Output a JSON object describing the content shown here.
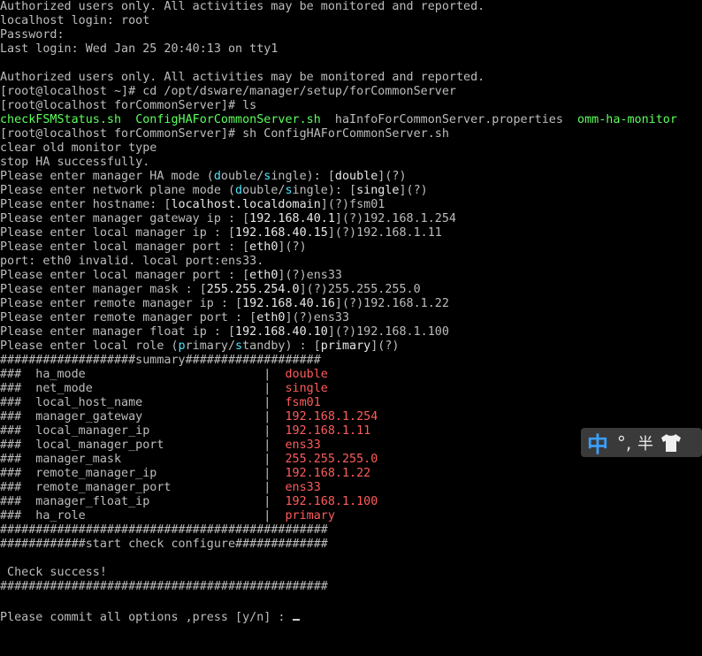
{
  "terminal": {
    "lines": [
      [
        {
          "t": "Authorized users only. All activities may be monitored and reported."
        }
      ],
      [
        {
          "t": "localhost login: root"
        }
      ],
      [
        {
          "t": "Password:"
        }
      ],
      [
        {
          "t": "Last login: Wed Jan 25 20:40:13 on tty1"
        }
      ],
      [
        {
          "t": ""
        }
      ],
      [
        {
          "t": "Authorized users only. All activities may be monitored and reported."
        }
      ],
      [
        {
          "t": "[root@localhost ~]# cd /opt/dsware/manager/setup/forCommonServer"
        }
      ],
      [
        {
          "t": "[root@localhost forCommonServer]# ls"
        }
      ],
      [
        {
          "t": "checkFSMStatus.sh",
          "c": "green"
        },
        {
          "t": "  "
        },
        {
          "t": "ConfigHAForCommonServer.sh",
          "c": "green"
        },
        {
          "t": "  haInfoForCommonServer.properties  "
        },
        {
          "t": "omm-ha-monitor",
          "c": "green"
        }
      ],
      [
        {
          "t": "[root@localhost forCommonServer]# sh ConfigHAForCommonServer.sh"
        }
      ],
      [
        {
          "t": "clear old monitor type"
        }
      ],
      [
        {
          "t": "stop HA successfully."
        }
      ],
      [
        {
          "t": "Please enter manager HA mode ("
        },
        {
          "t": "d",
          "c": "cyan"
        },
        {
          "t": "ouble/"
        },
        {
          "t": "s",
          "c": "cyan"
        },
        {
          "t": "ingle): ["
        },
        {
          "t": "double",
          "c": "bright"
        },
        {
          "t": "](?)"
        }
      ],
      [
        {
          "t": "Please enter network plane mode ("
        },
        {
          "t": "d",
          "c": "cyan"
        },
        {
          "t": "ouble/"
        },
        {
          "t": "s",
          "c": "cyan"
        },
        {
          "t": "ingle): ["
        },
        {
          "t": "single",
          "c": "bright"
        },
        {
          "t": "](?)"
        }
      ],
      [
        {
          "t": "Please enter hostname: ["
        },
        {
          "t": "localhost.localdomain",
          "c": "bright"
        },
        {
          "t": "](?)fsm01"
        }
      ],
      [
        {
          "t": "Please enter manager gateway ip : ["
        },
        {
          "t": "192.168.40.1",
          "c": "bright"
        },
        {
          "t": "](?)192.168.1.254"
        }
      ],
      [
        {
          "t": "Please enter local manager ip : ["
        },
        {
          "t": "192.168.40.15",
          "c": "bright"
        },
        {
          "t": "](?)192.168.1.11"
        }
      ],
      [
        {
          "t": "Please enter local manager port : ["
        },
        {
          "t": "eth0",
          "c": "bright"
        },
        {
          "t": "](?)"
        }
      ],
      [
        {
          "t": "port: eth0 invalid. local port:ens33."
        }
      ],
      [
        {
          "t": "Please enter local manager port : ["
        },
        {
          "t": "eth0",
          "c": "bright"
        },
        {
          "t": "](?)ens33"
        }
      ],
      [
        {
          "t": "Please enter manager mask : ["
        },
        {
          "t": "255.255.254.0",
          "c": "bright"
        },
        {
          "t": "](?)255.255.255.0"
        }
      ],
      [
        {
          "t": "Please enter remote manager ip : ["
        },
        {
          "t": "192.168.40.16",
          "c": "bright"
        },
        {
          "t": "](?)192.168.1.22"
        }
      ],
      [
        {
          "t": "Please enter remote manager port : ["
        },
        {
          "t": "eth0",
          "c": "bright"
        },
        {
          "t": "](?)ens33"
        }
      ],
      [
        {
          "t": "Please enter manager float ip : ["
        },
        {
          "t": "192.168.40.10",
          "c": "bright"
        },
        {
          "t": "](?)192.168.1.100"
        }
      ],
      [
        {
          "t": "Please enter local role ("
        },
        {
          "t": "p",
          "c": "cyan"
        },
        {
          "t": "rimary/"
        },
        {
          "t": "s",
          "c": "cyan"
        },
        {
          "t": "tandby) : ["
        },
        {
          "t": "primary",
          "c": "bright"
        },
        {
          "t": "](?)"
        }
      ],
      [
        {
          "t": "###################summary###################"
        }
      ],
      [
        {
          "t": "###  ha_mode                         |  "
        },
        {
          "t": "double",
          "c": "red"
        }
      ],
      [
        {
          "t": "###  net_mode                        |  "
        },
        {
          "t": "single",
          "c": "red"
        }
      ],
      [
        {
          "t": "###  local_host_name                 |  "
        },
        {
          "t": "fsm01",
          "c": "red"
        }
      ],
      [
        {
          "t": "###  manager_gateway                 |  "
        },
        {
          "t": "192.168.1.254",
          "c": "red"
        }
      ],
      [
        {
          "t": "###  local_manager_ip                |  "
        },
        {
          "t": "192.168.1.11",
          "c": "red"
        }
      ],
      [
        {
          "t": "###  local_manager_port              |  "
        },
        {
          "t": "ens33",
          "c": "red"
        }
      ],
      [
        {
          "t": "###  manager_mask                    |  "
        },
        {
          "t": "255.255.255.0",
          "c": "red"
        }
      ],
      [
        {
          "t": "###  remote_manager_ip               |  "
        },
        {
          "t": "192.168.1.22",
          "c": "red"
        }
      ],
      [
        {
          "t": "###  remote_manager_port             |  "
        },
        {
          "t": "ens33",
          "c": "red"
        }
      ],
      [
        {
          "t": "###  manager_float_ip                |  "
        },
        {
          "t": "192.168.1.100",
          "c": "red"
        }
      ],
      [
        {
          "t": "###  ha_role                         |  "
        },
        {
          "t": "primary",
          "c": "red"
        }
      ],
      [
        {
          "t": "##############################################"
        }
      ],
      [
        {
          "t": "############start check configure#############"
        }
      ],
      [
        {
          "t": ""
        }
      ],
      [
        {
          "t": " Check success!"
        }
      ],
      [
        {
          "t": "##############################################"
        }
      ],
      [
        {
          "t": ""
        }
      ],
      [
        {
          "t": "Please commit all options ,press [y/n] : "
        },
        {
          "t": "",
          "c": "cursor"
        }
      ]
    ]
  },
  "ime": {
    "mode": "中",
    "punct": "°,",
    "width": "半",
    "skin_icon": "shirt-icon"
  },
  "colors": {
    "background": "#000000",
    "text": "#bdbdbd",
    "highlight": "#e8e8e8",
    "cyan": "#4ae6ff",
    "green": "#5cff5c",
    "red": "#ff5c5c",
    "ime_mode": "#3aa0ff"
  }
}
